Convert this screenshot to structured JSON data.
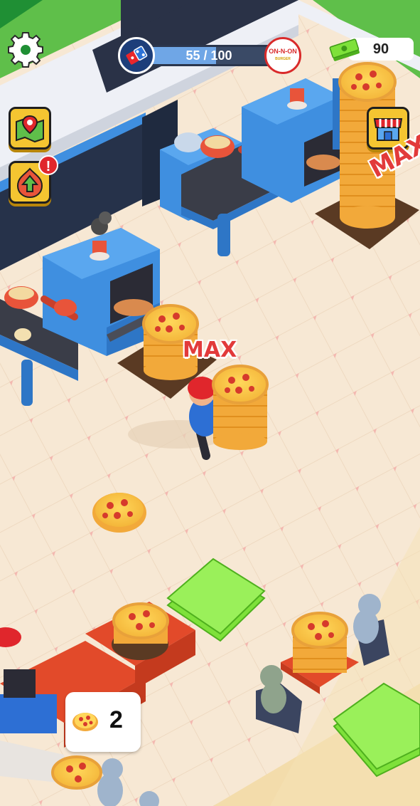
{
  "hud": {
    "settings_icon": "gear-icon",
    "progress": {
      "text": "55 / 100",
      "current": 55,
      "max": 100,
      "left_brand_icon": "domino-logo-icon",
      "right_brand": {
        "name": "ON-N-ON",
        "sub": "BURGER"
      }
    },
    "cash": {
      "value": "90",
      "icon": "cash-stack-icon"
    },
    "map_button_icon": "map-pin-icon",
    "upgrade_button_icon": "up-arrow-icon",
    "upgrade_alert": "!",
    "shop_button_icon": "storefront-icon"
  },
  "world": {
    "max_label_1": "MAX",
    "max_label_2": "MAX"
  },
  "carry_counter": {
    "icon": "pizza-icon",
    "count": "2"
  },
  "colors": {
    "accent_yellow": "#f4c531",
    "progress_fill": "#6fa6e6",
    "alert_red": "#e0262c",
    "max_red": "#e23a3a",
    "machine_blue": "#3f8fe0",
    "floor": "#f6e7d2",
    "cash_green": "#7ee13a"
  }
}
